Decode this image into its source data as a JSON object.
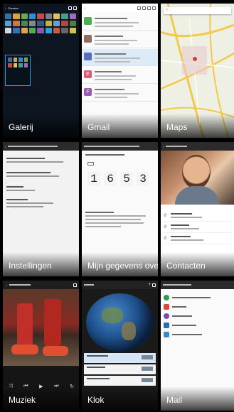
{
  "apps": [
    {
      "label": "Galerij"
    },
    {
      "label": "Gmail"
    },
    {
      "label": "Maps"
    },
    {
      "label": "Instellingen"
    },
    {
      "label": "Mijn gegevens ove..."
    },
    {
      "label": "Contacten"
    },
    {
      "label": "Muziek"
    },
    {
      "label": "Klok"
    },
    {
      "label": "Mail"
    }
  ],
  "gallery": {
    "header": "Camera"
  },
  "numbers_preview": {
    "digits": [
      "1",
      "6",
      "5",
      "3"
    ]
  },
  "gmail": {
    "avatars": [
      {
        "letter": "",
        "color": "#4caf50"
      },
      {
        "letter": "",
        "color": "#8d6e63"
      },
      {
        "letter": "",
        "color": "#5c6bc0"
      },
      {
        "letter": "E",
        "color": "#e05570"
      },
      {
        "letter": "F",
        "color": "#9c5bb5"
      }
    ]
  },
  "colors": {
    "accent": "#2a9bd5",
    "map_road": "#f2c94c",
    "map_land": "#eef0e4"
  }
}
